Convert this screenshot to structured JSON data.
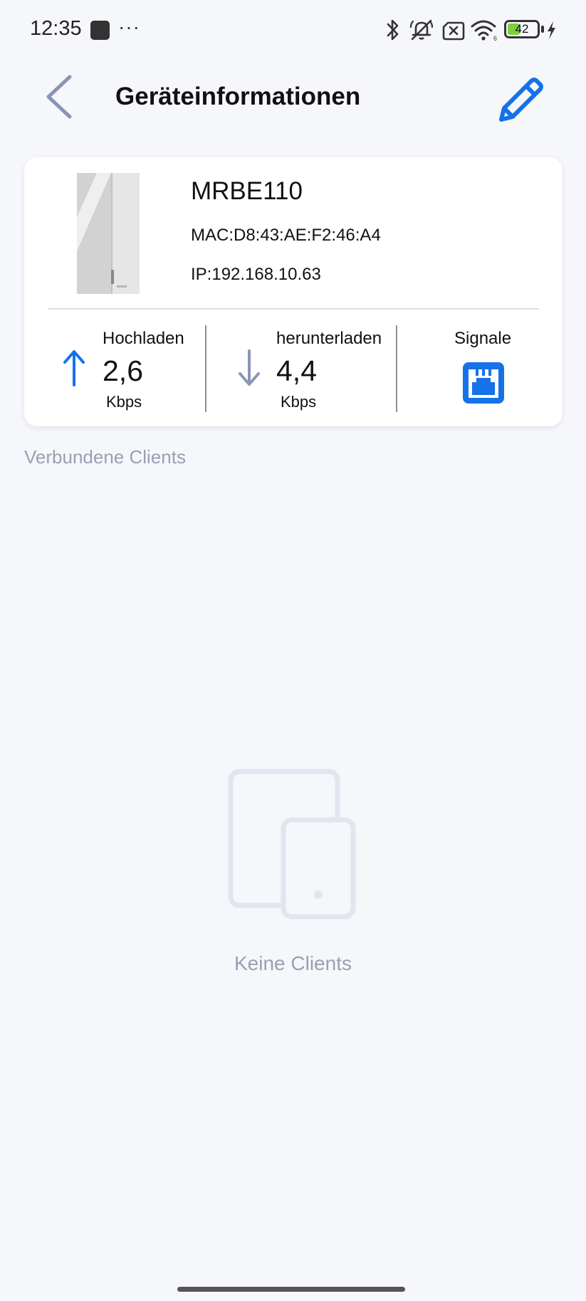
{
  "status_bar": {
    "time": "12:35",
    "more": "···",
    "battery": "42",
    "battery_level": 0.42,
    "icons": [
      "bluetooth-icon",
      "mute-icon",
      "no-sim-icon",
      "wifi-icon",
      "battery-icon",
      "charging-icon"
    ]
  },
  "header": {
    "title": "Geräteinformationen",
    "back_icon": "chevron-left-icon",
    "edit_icon": "pencil-icon"
  },
  "device": {
    "name": "MRBE110",
    "mac": "MAC:D8:43:AE:F2:46:A4",
    "ip": "IP:192.168.10.63"
  },
  "stats": {
    "upload": {
      "label": "Hochladen",
      "value": "2,6",
      "unit": "Kbps"
    },
    "download": {
      "label": "herunterladen",
      "value": "4,4",
      "unit": "Kbps"
    },
    "signal": {
      "label": "Signale",
      "icon": "ethernet-port-icon"
    }
  },
  "clients": {
    "section_label": "Verbundene Clients",
    "empty_label": "Keine Clients"
  },
  "colors": {
    "accent": "#1572e8",
    "muted_icon": "#8a95b5",
    "muted_text": "#98a0b3",
    "background": "#f6f7fb"
  }
}
